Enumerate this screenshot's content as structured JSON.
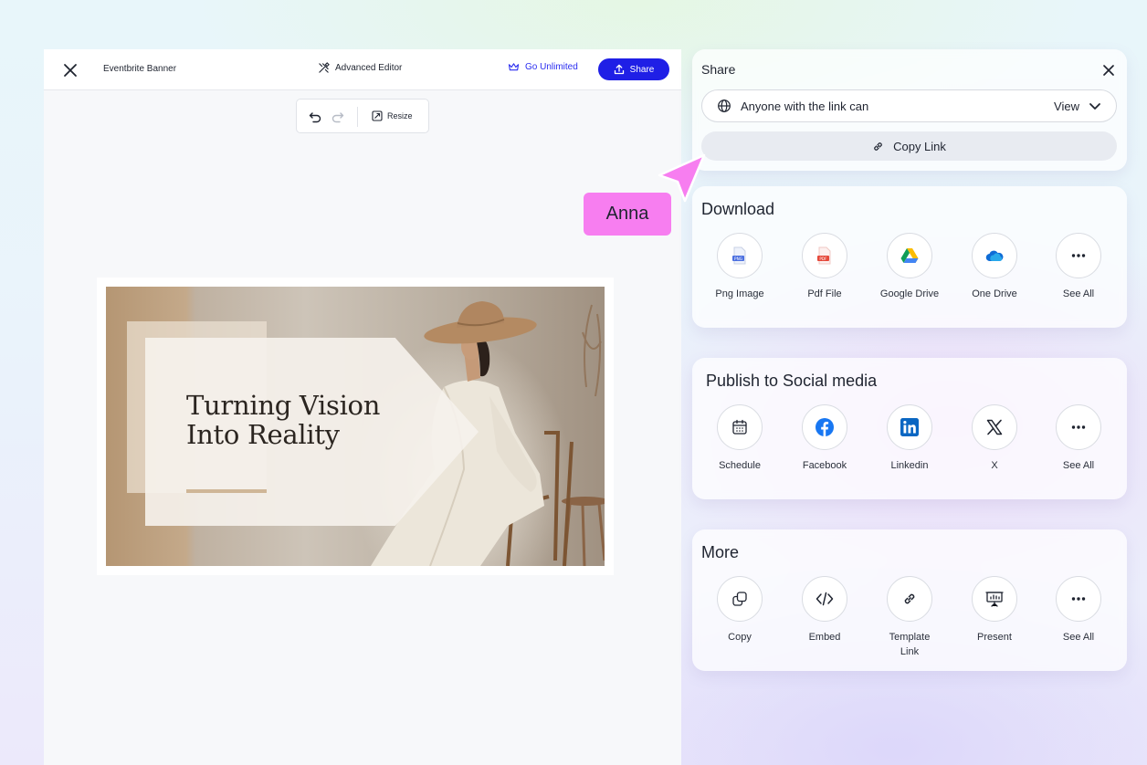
{
  "editor": {
    "doc_title": "Eventbrite Banner",
    "advanced_editor_label": "Advanced Editor",
    "go_unlimited_label": "Go Unlimited",
    "share_label": "Share",
    "resize_label": "Resize"
  },
  "design": {
    "headline_line1": "Turning Vision",
    "headline_line2": "Into Reality"
  },
  "share_panel": {
    "title": "Share",
    "access_text": "Anyone with the link can",
    "access_value": "View",
    "copy_link_label": "Copy Link"
  },
  "download": {
    "title": "Download",
    "options": [
      {
        "label": "Png Image",
        "icon": "png-file-icon"
      },
      {
        "label": "Pdf File",
        "icon": "pdf-file-icon"
      },
      {
        "label": "Google Drive",
        "icon": "google-drive-icon"
      },
      {
        "label": "One Drive",
        "icon": "onedrive-icon"
      },
      {
        "label": "See All",
        "icon": "more-dots-icon"
      }
    ]
  },
  "social": {
    "title": "Publish to Social media",
    "options": [
      {
        "label": "Schedule",
        "icon": "calendar-icon"
      },
      {
        "label": "Facebook",
        "icon": "facebook-icon"
      },
      {
        "label": "Linkedin",
        "icon": "linkedin-icon"
      },
      {
        "label": "X",
        "icon": "x-logo-icon"
      },
      {
        "label": "See All",
        "icon": "more-dots-icon"
      }
    ]
  },
  "more": {
    "title": "More",
    "options": [
      {
        "label": "Copy",
        "icon": "copy-icon"
      },
      {
        "label": "Embed",
        "icon": "code-icon"
      },
      {
        "label": "Template Link",
        "icon": "link-icon"
      },
      {
        "label": "Present",
        "icon": "presentation-icon"
      },
      {
        "label": "See All",
        "icon": "more-dots-icon"
      }
    ]
  },
  "collaborator": {
    "name": "Anna",
    "color": "#f77ef0"
  },
  "colors": {
    "primary": "#1f1fe6",
    "facebook": "#1877f2",
    "linkedin": "#0a66c2"
  }
}
